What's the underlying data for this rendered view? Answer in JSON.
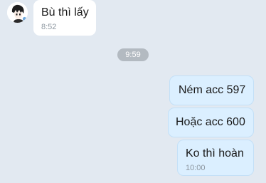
{
  "conversation": {
    "incoming": {
      "text": "Bù thì lấy",
      "time": "8:52"
    },
    "divider_time": "9:59",
    "outgoing": [
      {
        "text": "Ném acc 597"
      },
      {
        "text": "Hoặc acc 600"
      },
      {
        "text": "Ko thì hoàn",
        "time": "10:00"
      }
    ]
  },
  "colors": {
    "background": "#e2e9f1",
    "incoming_bubble": "#ffffff",
    "outgoing_bubble": "#dbefff",
    "timestamp": "#8d97a0",
    "divider_pill": "#b3bac1"
  },
  "icons": {
    "avatar": "sender-avatar-icon"
  }
}
